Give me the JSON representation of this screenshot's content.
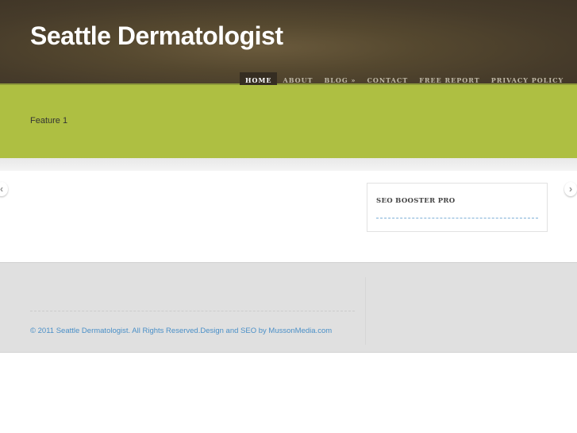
{
  "header": {
    "site_title": "Seattle Dermatologist"
  },
  "nav": {
    "items": [
      {
        "label": "HOME"
      },
      {
        "label": "ABOUT"
      },
      {
        "label": "BLOG »"
      },
      {
        "label": "CONTACT"
      },
      {
        "label": "FREE REPORT"
      },
      {
        "label": "PRIVACY POLICY"
      }
    ]
  },
  "feature": {
    "text": "Feature 1",
    "prev": "‹",
    "next": "›"
  },
  "sidebar": {
    "widget_title": "SEO BOOSTER PRO"
  },
  "footer": {
    "copyright": "© 2011 Seattle Dermatologist. All Rights Reserved.Design and SEO by MussonMedia.com"
  }
}
